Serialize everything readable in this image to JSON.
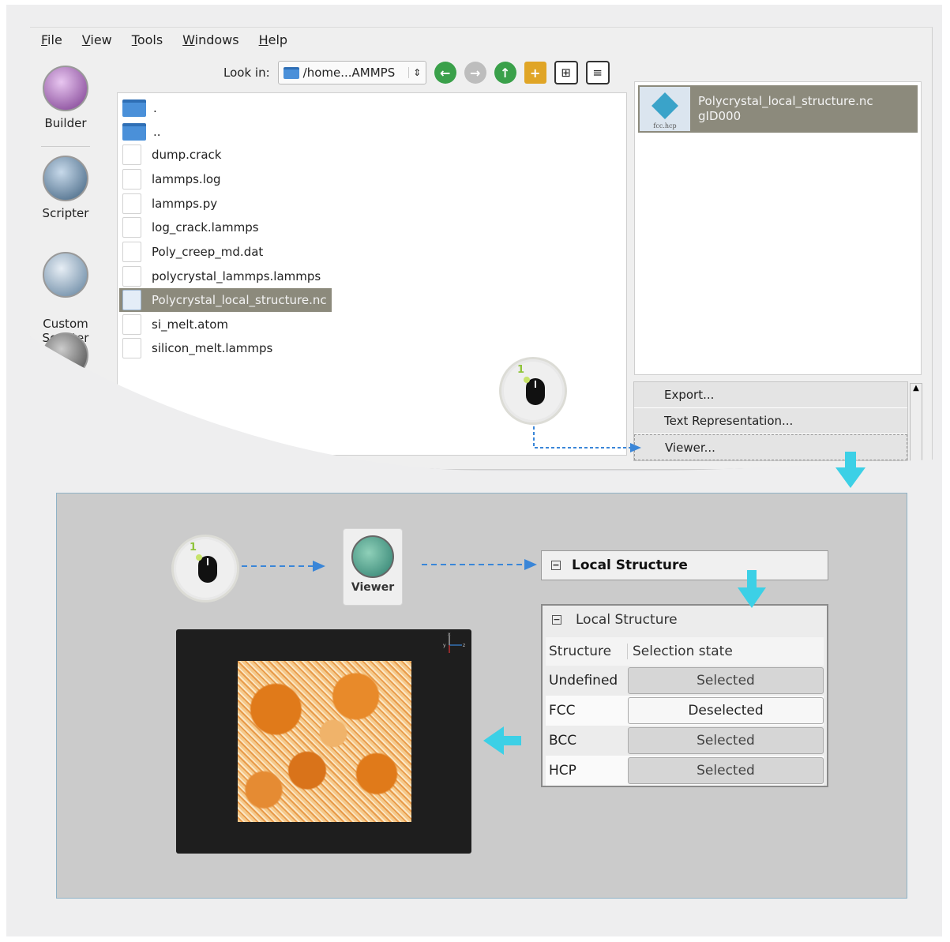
{
  "menu": [
    "File",
    "View",
    "Tools",
    "Windows",
    "Help"
  ],
  "sidebar": [
    {
      "label": "Builder",
      "icon": "builder-icon"
    },
    {
      "label": "Scripter",
      "icon": "scripter-icon"
    },
    {
      "label": "Custom\nScripter",
      "icon": "custom-scripter-icon"
    }
  ],
  "toolbar": {
    "look_in_label": "Look in:",
    "path": "/home...AMMPS"
  },
  "files": [
    {
      "name": ".",
      "type": "folder"
    },
    {
      "name": "..",
      "type": "folder"
    },
    {
      "name": "dump.crack",
      "type": "file"
    },
    {
      "name": "lammps.log",
      "type": "file"
    },
    {
      "name": "lammps.py",
      "type": "file"
    },
    {
      "name": "log_crack.lammps",
      "type": "file"
    },
    {
      "name": "Poly_creep_md.dat",
      "type": "file"
    },
    {
      "name": "polycrystal_lammps.lammps",
      "type": "file"
    },
    {
      "name": "Polycrystal_local_structure.nc",
      "type": "file",
      "selected": true
    },
    {
      "name": "si_melt.atom",
      "type": "file"
    },
    {
      "name": "silicon_melt.lammps",
      "type": "file"
    }
  ],
  "right_panel": {
    "item_title": "Polycrystal_local_structure.nc",
    "item_subtitle": "gID000",
    "thumb_caption": "fcc.hcp"
  },
  "context_menu": [
    "Export...",
    "Text Representation...",
    "Viewer..."
  ],
  "mouse_badge_number": "1",
  "viewer_label": "Viewer",
  "local_structure": {
    "header": "Local Structure",
    "panel_title": "Local Structure",
    "columns": [
      "Structure",
      "Selection state"
    ],
    "rows": [
      {
        "structure": "Undefined",
        "state": "Selected"
      },
      {
        "structure": "FCC",
        "state": "Deselected"
      },
      {
        "structure": "BCC",
        "state": "Selected"
      },
      {
        "structure": "HCP",
        "state": "Selected"
      }
    ]
  },
  "axes": {
    "x": "x",
    "y": "y",
    "z": "z"
  },
  "colors": {
    "selection": "#8c8a7c",
    "arrow": "#3cd0e6",
    "dash": "#3a86d8",
    "panel_bg": "#cbcbcb"
  }
}
